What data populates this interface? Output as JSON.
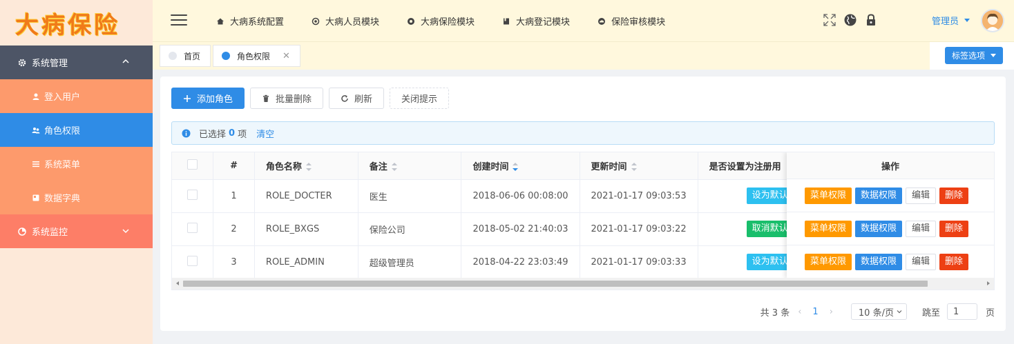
{
  "logo_text": "大病保险",
  "sidebar": {
    "group1": "系统管理",
    "items": [
      {
        "label": "登入用户",
        "icon": "user-icon"
      },
      {
        "label": "角色权限",
        "icon": "users-icon",
        "active": true
      },
      {
        "label": "系统菜单",
        "icon": "menu-icon"
      },
      {
        "label": "数据字典",
        "icon": "book-icon"
      }
    ],
    "group2": "系统监控"
  },
  "header": {
    "nav": [
      {
        "label": "大病系统配置",
        "icon": "home-icon"
      },
      {
        "label": "大病人员模块",
        "icon": "target-icon"
      },
      {
        "label": "大病保险模块",
        "icon": "at-icon"
      },
      {
        "label": "大病登记模块",
        "icon": "bookmark-icon"
      },
      {
        "label": "保险审核模块",
        "icon": "cloud-icon"
      }
    ],
    "user": "管理员"
  },
  "tags": {
    "home": "首页",
    "current": "角色权限",
    "options": "标签选项"
  },
  "toolbar": {
    "add": "添加角色",
    "batch_delete": "批量删除",
    "refresh": "刷新",
    "close_tip": "关闭提示"
  },
  "alert": {
    "prefix": "已选择",
    "count": "0",
    "suffix": "项",
    "clear": "清空"
  },
  "table": {
    "headers": [
      "#",
      "角色名称",
      "备注",
      "创建时间",
      "更新时间",
      "是否设置为注册用",
      "操作"
    ],
    "rows": [
      {
        "idx": "1",
        "name": "ROLE_DOCTER",
        "remark": "医生",
        "created": "2018-06-06 00:08:00",
        "updated": "2021-01-17 09:03:53",
        "reg": "设为默认"
      },
      {
        "idx": "2",
        "name": "ROLE_BXGS",
        "remark": "保险公司",
        "created": "2018-05-02 21:40:03",
        "updated": "2021-01-17 09:03:22",
        "reg": "取消默认"
      },
      {
        "idx": "3",
        "name": "ROLE_ADMIN",
        "remark": "超级管理员",
        "created": "2018-04-22 23:03:49",
        "updated": "2021-01-17 09:03:33",
        "reg": "设为默认"
      }
    ],
    "ops": [
      "菜单权限",
      "数据权限",
      "编辑",
      "删除"
    ]
  },
  "pager": {
    "total": "共 3 条",
    "page": "1",
    "size": "10 条/页",
    "jump": "跳至",
    "jump_value": "1",
    "page_unit": "页"
  },
  "colors": {
    "accent": "#2f8ce6",
    "sidebar_item": "#fd9a6c",
    "sidebar_group": "#4d5566",
    "header_bg": "#fff8dd"
  }
}
